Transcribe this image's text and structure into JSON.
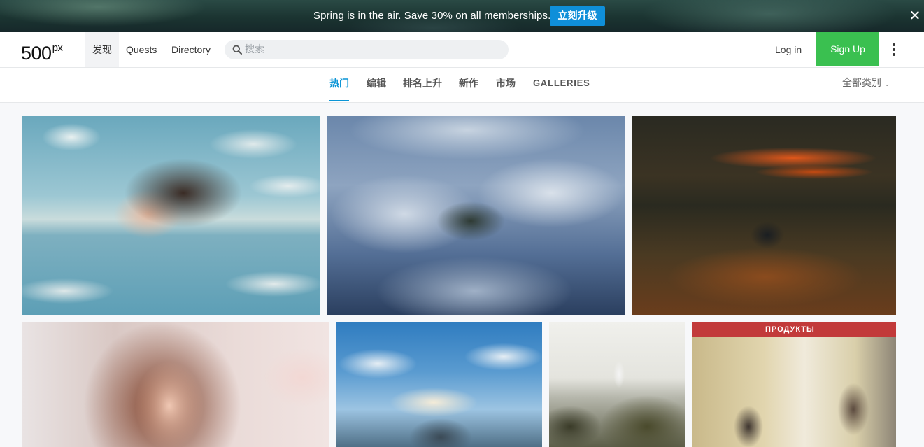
{
  "promo": {
    "text": "Spring is in the air. Save 30% on all memberships.",
    "button": "立刻升级",
    "close": "✕"
  },
  "header": {
    "logo": "500",
    "logo_sup": "px",
    "nav": [
      "发现",
      "Quests",
      "Directory"
    ],
    "search_placeholder": "搜索",
    "login": "Log in",
    "signup": "Sign Up"
  },
  "tabs": {
    "items": [
      "热门",
      "编辑",
      "排名上升",
      "新作",
      "市场",
      "GALLERIES"
    ],
    "active_index": 0,
    "category_filter": "全部类别",
    "accent": "#0b95d6"
  },
  "photos": {
    "sign_text": "ПРОДУКТЫ"
  },
  "colors": {
    "signup_bg": "#3ac050",
    "promo_button_bg": "#0f8fd9"
  }
}
